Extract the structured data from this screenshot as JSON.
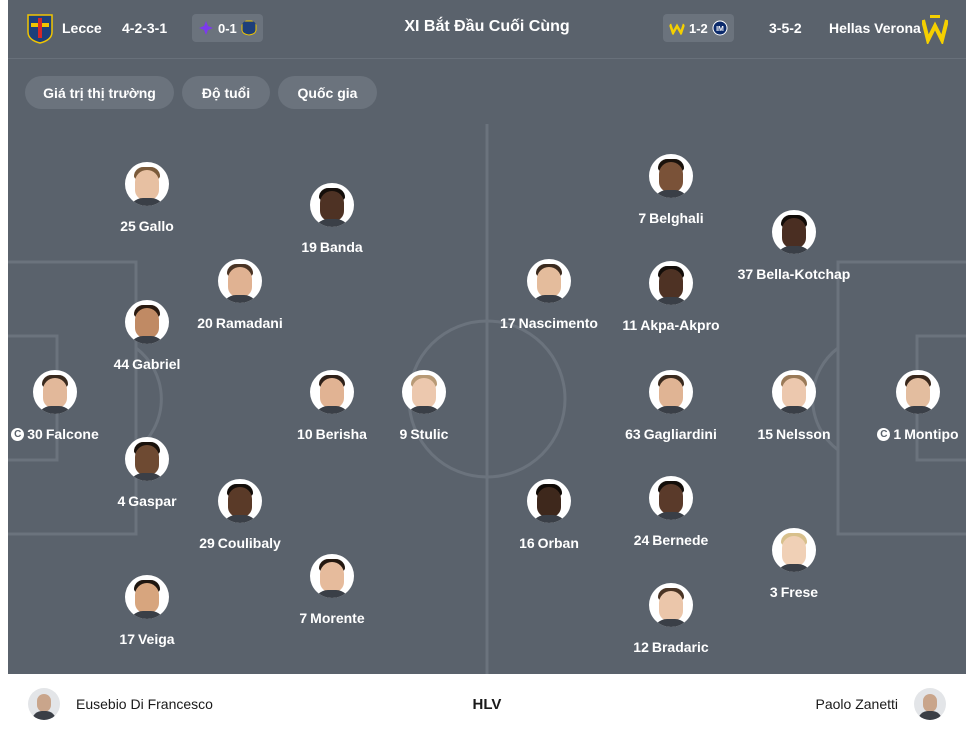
{
  "header": {
    "title": "XI Bắt Đầu Cuối Cùng",
    "home": {
      "name": "Lecce",
      "formation": "4-2-3-1",
      "last_score": "0-1",
      "last_opponent_logo": "fiorentina-logo",
      "logo": "lecce-logo",
      "colors": {
        "primary": "#1e3f7a",
        "secondary": "#f1c500"
      }
    },
    "away": {
      "name": "Hellas Verona",
      "formation": "3-5-2",
      "last_score": "1-2",
      "last_opponent_logo": "inter-logo",
      "logo": "hellas-verona-logo",
      "colors": {
        "primary": "#f5d000",
        "secondary": "#1d3c73"
      }
    }
  },
  "filters": [
    "Giá trị thị trường",
    "Độ tuổi",
    "Quốc gia"
  ],
  "lineup": {
    "home": [
      {
        "number": "30",
        "name": "Falcone",
        "captain": true,
        "skin": "#e2b89a",
        "hair": "#3a2a1e"
      },
      {
        "number": "25",
        "name": "Gallo",
        "captain": false,
        "skin": "#e7c0a2",
        "hair": "#7a5a3a"
      },
      {
        "number": "44",
        "name": "Gabriel",
        "captain": false,
        "skin": "#c08a64",
        "hair": "#2a1a10"
      },
      {
        "number": "4",
        "name": "Gaspar",
        "captain": false,
        "skin": "#6e4a32",
        "hair": "#1a120c"
      },
      {
        "number": "17",
        "name": "Veiga",
        "captain": false,
        "skin": "#d7a57e",
        "hair": "#1e1610"
      },
      {
        "number": "20",
        "name": "Ramadani",
        "captain": false,
        "skin": "#e0b292",
        "hair": "#4a3424"
      },
      {
        "number": "29",
        "name": "Coulibaly",
        "captain": false,
        "skin": "#5a3a28",
        "hair": "#140e0a"
      },
      {
        "number": "19",
        "name": "Banda",
        "captain": false,
        "skin": "#4e3224",
        "hair": "#140e0a"
      },
      {
        "number": "10",
        "name": "Berisha",
        "captain": false,
        "skin": "#e1b393",
        "hair": "#2e2018"
      },
      {
        "number": "7",
        "name": "Morente",
        "captain": false,
        "skin": "#e6bb9c",
        "hair": "#241810"
      },
      {
        "number": "9",
        "name": "Stulic",
        "captain": false,
        "skin": "#ecc8ae",
        "hair": "#b89a76"
      }
    ],
    "away": [
      {
        "number": "1",
        "name": "Montipo",
        "captain": true,
        "skin": "#e3bd9f",
        "hair": "#3a281c"
      },
      {
        "number": "15",
        "name": "Nelsson",
        "captain": false,
        "skin": "#ecc8ae",
        "hair": "#9a7a58"
      },
      {
        "number": "3",
        "name": "Frese",
        "captain": false,
        "skin": "#f0d0b6",
        "hair": "#d8c08c"
      },
      {
        "number": "37",
        "name": "Bella-Kotchap",
        "captain": false,
        "skin": "#4a2e22",
        "hair": "#120c08"
      },
      {
        "number": "63",
        "name": "Gagliardini",
        "captain": false,
        "skin": "#e0b494",
        "hair": "#3a2a1e"
      },
      {
        "number": "24",
        "name": "Bernede",
        "captain": false,
        "skin": "#5a3a2a",
        "hair": "#140e0a"
      },
      {
        "number": "12",
        "name": "Bradaric",
        "captain": false,
        "skin": "#ebc6aa",
        "hair": "#4a3424"
      },
      {
        "number": "7",
        "name": "Belghali",
        "captain": false,
        "skin": "#7a5238",
        "hair": "#1a120c"
      },
      {
        "number": "11",
        "name": "Akpa-Akpro",
        "captain": false,
        "skin": "#4e3224",
        "hair": "#140e0a"
      },
      {
        "number": "16",
        "name": "Orban",
        "captain": false,
        "skin": "#3e281c",
        "hair": "#100a06"
      },
      {
        "number": "17",
        "name": "Nascimento",
        "captain": false,
        "skin": "#e4bc9c",
        "hair": "#3a2a1e"
      }
    ]
  },
  "coaches": {
    "label": "HLV",
    "home": "Eusebio Di Francesco",
    "away": "Paolo Zanetti"
  }
}
